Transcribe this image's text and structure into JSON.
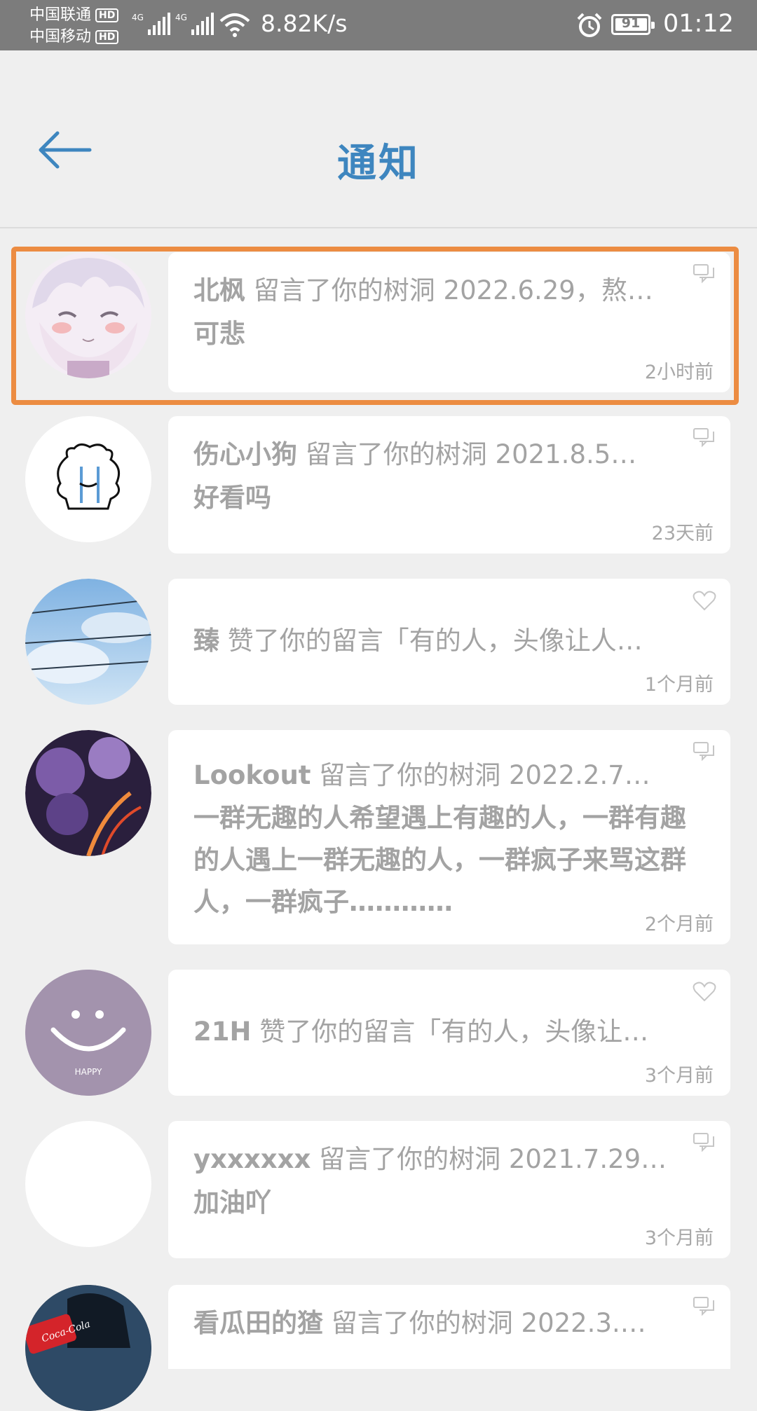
{
  "status_bar": {
    "carrier1": "中国联通",
    "carrier2": "中国移动",
    "hd": "HD",
    "net1": "4G",
    "net2": "4G",
    "net_speed": "8.82K/s",
    "battery": "91",
    "time": "01:12"
  },
  "header": {
    "title": "通知",
    "back_icon": "arrow-left-icon"
  },
  "notifications": [
    {
      "name": "北枫",
      "action": " 留言了你的树洞 2022.6.29，熬…",
      "body": "可悲",
      "time": "2小时前",
      "icon": "comment-icon"
    },
    {
      "name": "伤心小狗",
      "action": " 留言了你的树洞 2021.8.5…",
      "body": "好看吗",
      "time": "23天前",
      "icon": "comment-icon"
    },
    {
      "name": "臻",
      "action": " 赞了你的留言「有的人，头像让人…",
      "body": "",
      "time": "1个月前",
      "icon": "heart-icon"
    },
    {
      "name": "Lookout",
      "action": "  留言了你的树洞 2022.2.7…",
      "body": "一群无趣的人希望遇上有趣的人，一群有趣的人遇上一群无趣的人，一群疯子来骂这群人，一群疯子…………",
      "time": "2个月前",
      "icon": "comment-icon"
    },
    {
      "name": "21H",
      "action": " 赞了你的留言「有的人，头像让…",
      "body": "",
      "time": "3个月前",
      "icon": "heart-icon"
    },
    {
      "name": "yxxxxxx",
      "action": " 留言了你的树洞 2021.7.29…",
      "body": "加油吖",
      "time": "3个月前",
      "icon": "comment-icon"
    },
    {
      "name": "看瓜田的猹",
      "action": " 留言了你的树洞 2022.3.…",
      "body": "",
      "time": "",
      "icon": "comment-icon"
    }
  ],
  "avatar_texts": {
    "happy": "HAPPY",
    "cola": "Coca-Cola"
  },
  "colors": {
    "accent": "#3e86bf",
    "highlight": "#ec8c42",
    "text_gray": "#a3a3a3"
  }
}
